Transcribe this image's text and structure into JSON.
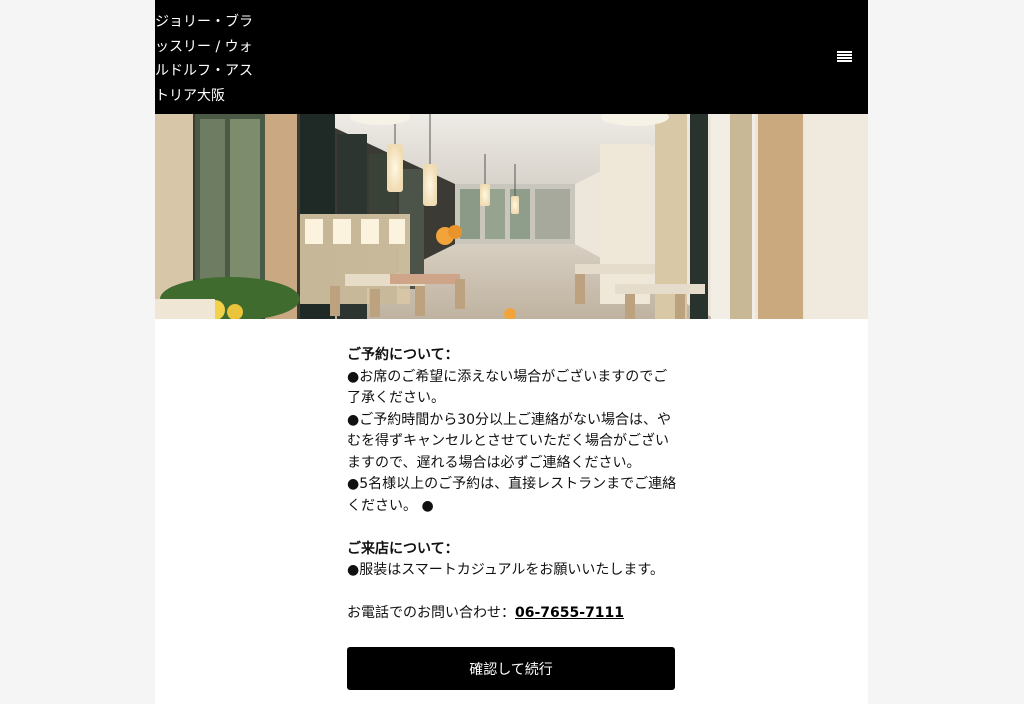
{
  "header": {
    "brand": "ジョリー・ブラッスリー / ウォルドルフ・アストリア大阪",
    "menu_icon": "hamburger-menu-icon"
  },
  "hero": {
    "image": "restaurant-interior-photo"
  },
  "reservation": {
    "heading": "ご予約について：",
    "line1": "●お席のご希望に添えない場合がございますのでご了承ください。",
    "line2": "●ご予約時間から30分以上ご連絡がない場合は、やむを得ずキャンセルとさせていただく場合がございますので、遅れる場合は必ずご連絡ください。",
    "line3": "●5名様以上のご予約は、直接レストランまでご連絡ください。 ●"
  },
  "visit": {
    "heading": "ご来店について：",
    "line1": "●服装はスマートカジュアルをお願いいたします。"
  },
  "contact": {
    "label": "お電話でのお問い合わせ：",
    "phone": "06-7655-7111"
  },
  "actions": {
    "confirm_label": "確認して続行"
  },
  "colors": {
    "header_bg": "#000000",
    "button_bg": "#000000",
    "page_bg": "#ffffff",
    "outer_bg": "#f5f5f5"
  }
}
